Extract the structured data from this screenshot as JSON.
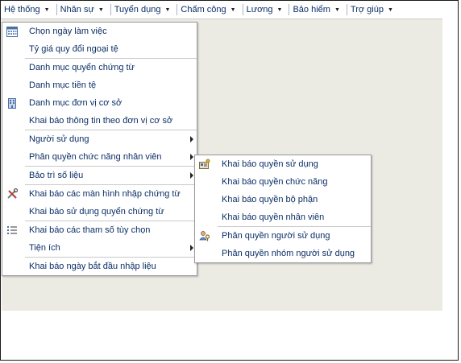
{
  "menubar": [
    {
      "label": "Hệ thống",
      "name": "menu-he-thong"
    },
    {
      "label": "Nhân sự",
      "name": "menu-nhan-su"
    },
    {
      "label": "Tuyển dụng",
      "name": "menu-tuyen-dung"
    },
    {
      "label": "Chấm công",
      "name": "menu-cham-cong"
    },
    {
      "label": "Lương",
      "name": "menu-luong"
    },
    {
      "label": "Bảo hiểm",
      "name": "menu-bao-hiem"
    },
    {
      "label": "Trợ giúp",
      "name": "menu-tro-giup"
    }
  ],
  "main_menu": {
    "g1": {
      "chon_ngay": "Chọn ngày làm việc",
      "ty_gia": "Tỷ giá quy đổi ngoại tệ"
    },
    "g2": {
      "dm_quyen": "Danh mục quyển chứng từ",
      "dm_tien_te": "Danh mục tiền tệ",
      "dm_don_vi": "Danh mục đơn vị cơ sở",
      "kb_thong_tin": "Khai báo thông tin theo đơn vị cơ sở"
    },
    "g3": {
      "nguoi_su_dung": "Người sử dụng",
      "phan_quyen": "Phân quyền chức năng nhân viên"
    },
    "g4": {
      "bao_tri": "Bảo trì số liệu"
    },
    "g5": {
      "kb_man_hinh": "Khai báo các màn hình nhập chứng từ",
      "kb_su_dung_quyen": "Khai báo sử dụng quyển chứng từ"
    },
    "g6": {
      "kb_tham_so": "Khai báo các tham số tùy chọn",
      "tien_ich": "Tiện ích"
    },
    "g7": {
      "kb_ngay": "Khai báo ngày bắt đầu nhập liệu"
    }
  },
  "sub_menu": {
    "kb_quyen_su_dung": "Khai báo quyền sử dụng",
    "kb_quyen_chuc_nang": "Khai báo quyền chức năng",
    "kb_quyen_bo_phan": "Khai báo quyền bộ phận",
    "kb_quyen_nhan_vien": "Khai báo quyền nhân viên",
    "pq_nguoi_su_dung": "Phân quyền người sử dụng",
    "pq_nhom": "Phân quyền nhóm người sử dụng"
  },
  "icons": {
    "calendar": "calendar-icon",
    "building": "building-icon",
    "tools": "tools-icon",
    "list": "list-icon",
    "key-card": "key-card-icon",
    "users-key": "users-key-icon"
  }
}
